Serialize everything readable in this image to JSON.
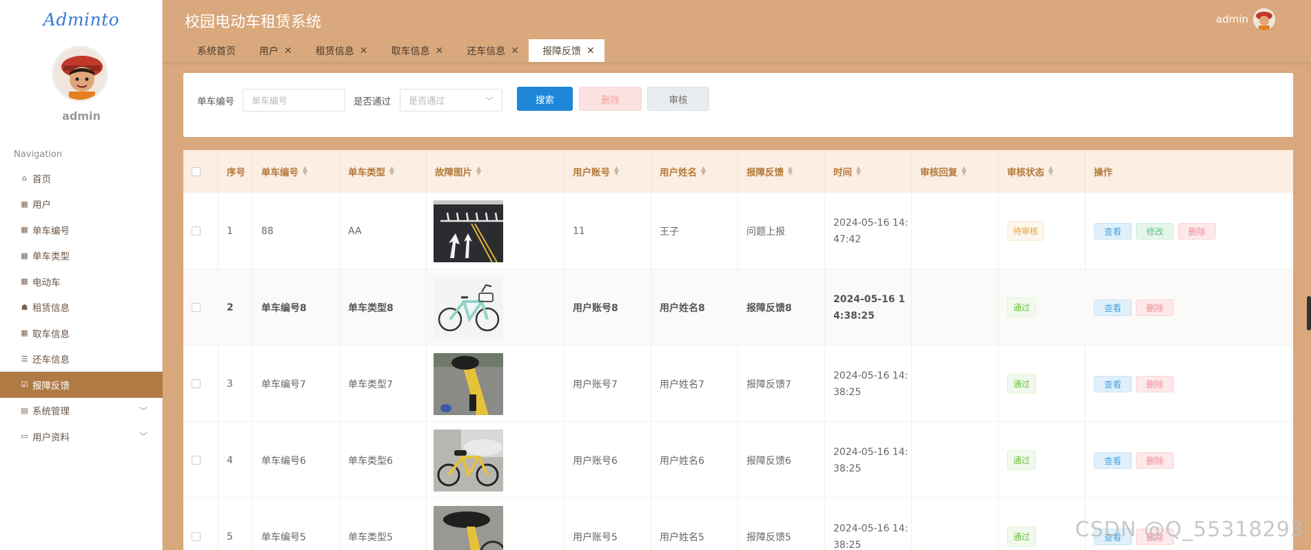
{
  "sidebar": {
    "logo": "Adminto",
    "username": "admin",
    "nav_title": "Navigation",
    "items": [
      {
        "label": "首页",
        "icon": "home-icon"
      },
      {
        "label": "用户",
        "icon": "grid-icon"
      },
      {
        "label": "单车编号",
        "icon": "grid-icon"
      },
      {
        "label": "单车类型",
        "icon": "grid-icon"
      },
      {
        "label": "电动车",
        "icon": "grid-icon"
      },
      {
        "label": "租赁信息",
        "icon": "thumb-icon"
      },
      {
        "label": "取车信息",
        "icon": "grid-icon"
      },
      {
        "label": "还车信息",
        "icon": "list-icon"
      },
      {
        "label": "报障反馈",
        "icon": "check-icon"
      },
      {
        "label": "系统管理",
        "icon": "clipboard-icon"
      },
      {
        "label": "用户资料",
        "icon": "card-icon"
      }
    ]
  },
  "header": {
    "title": "校园电动车租赁系统",
    "user": "admin"
  },
  "tabs": [
    {
      "label": "系统首页",
      "closable": false
    },
    {
      "label": "用户",
      "closable": true
    },
    {
      "label": "租赁信息",
      "closable": true
    },
    {
      "label": "取车信息",
      "closable": true
    },
    {
      "label": "还车信息",
      "closable": true
    },
    {
      "label": "报障反馈",
      "closable": true,
      "active": true
    }
  ],
  "search": {
    "bike_no_label": "单车编号",
    "bike_no_placeholder": "单车编号",
    "pass_label": "是否通过",
    "pass_placeholder": "是否通过",
    "search_btn": "搜索",
    "delete_btn": "删除",
    "audit_btn": "审核"
  },
  "table": {
    "headers": [
      "序号",
      "单车编号",
      "单车类型",
      "故障图片",
      "用户账号",
      "用户姓名",
      "报障反馈",
      "时间",
      "审核回复",
      "审核状态",
      "操作"
    ],
    "rows": [
      {
        "no": "1",
        "bike_no": "88",
        "bike_type": "AA",
        "account": "11",
        "name": "王子",
        "feedback": "问题上报",
        "time1": "2024-05-16 14:",
        "time2": "47:42",
        "reply": "",
        "status": "待审核",
        "status_kind": "pending",
        "ops": [
          "查看",
          "修改",
          "删除"
        ]
      },
      {
        "no": "2",
        "bike_no": "单车编号8",
        "bike_type": "单车类型8",
        "account": "用户账号8",
        "name": "用户姓名8",
        "feedback": "报障反馈8",
        "time1": "2024-05-16 1",
        "time2": "4:38:25",
        "reply": "",
        "status": "通过",
        "status_kind": "pass",
        "ops": [
          "查看",
          "删除"
        ]
      },
      {
        "no": "3",
        "bike_no": "单车编号7",
        "bike_type": "单车类型7",
        "account": "用户账号7",
        "name": "用户姓名7",
        "feedback": "报障反馈7",
        "time1": "2024-05-16 14:",
        "time2": "38:25",
        "reply": "",
        "status": "通过",
        "status_kind": "pass",
        "ops": [
          "查看",
          "删除"
        ]
      },
      {
        "no": "4",
        "bike_no": "单车编号6",
        "bike_type": "单车类型6",
        "account": "用户账号6",
        "name": "用户姓名6",
        "feedback": "报障反馈6",
        "time1": "2024-05-16 14:",
        "time2": "38:25",
        "reply": "",
        "status": "通过",
        "status_kind": "pass",
        "ops": [
          "查看",
          "删除"
        ]
      },
      {
        "no": "5",
        "bike_no": "单车编号5",
        "bike_type": "单车类型5",
        "account": "用户账号5",
        "name": "用户姓名5",
        "feedback": "报障反馈5",
        "time1": "2024-05-16 14:",
        "time2": "38:25",
        "reply": "",
        "status": "通过",
        "status_kind": "pass",
        "ops": [
          "查看",
          "删除"
        ]
      }
    ]
  },
  "watermark": "CSDN @Q_55318293",
  "colors": {
    "accent": "#d9a87c",
    "active_nav": "#b07a45",
    "primary_btn": "#1e87d9"
  }
}
